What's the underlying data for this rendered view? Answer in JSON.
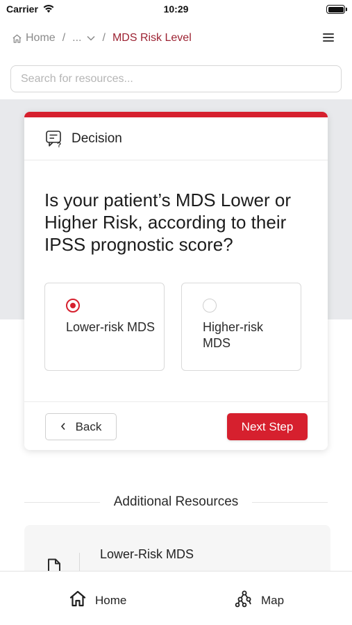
{
  "status_bar": {
    "carrier": "Carrier",
    "time": "10:29"
  },
  "breadcrumb": {
    "home": "Home",
    "ellipsis": "...",
    "separator": "/",
    "current": "MDS Risk Level"
  },
  "search": {
    "placeholder": "Search for resources..."
  },
  "decision": {
    "header": "Decision",
    "question": "Is your patient’s MDS Lower or Higher Risk, according to their IPSS prognostic score?",
    "options": [
      {
        "label": "Lower-risk MDS",
        "selected": true
      },
      {
        "label": "Higher-risk MDS",
        "selected": false
      }
    ],
    "back_label": "Back",
    "next_label": "Next Step"
  },
  "resources": {
    "title": "Additional Resources",
    "items": [
      {
        "title": "Lower-Risk MDS",
        "icon": "document-icon"
      }
    ]
  },
  "tabbar": {
    "home_label": "Home",
    "map_label": "Map"
  },
  "colors": {
    "accent": "#d6202e",
    "breadcrumb_current": "#9c2232",
    "band": "#e8e9ec"
  }
}
